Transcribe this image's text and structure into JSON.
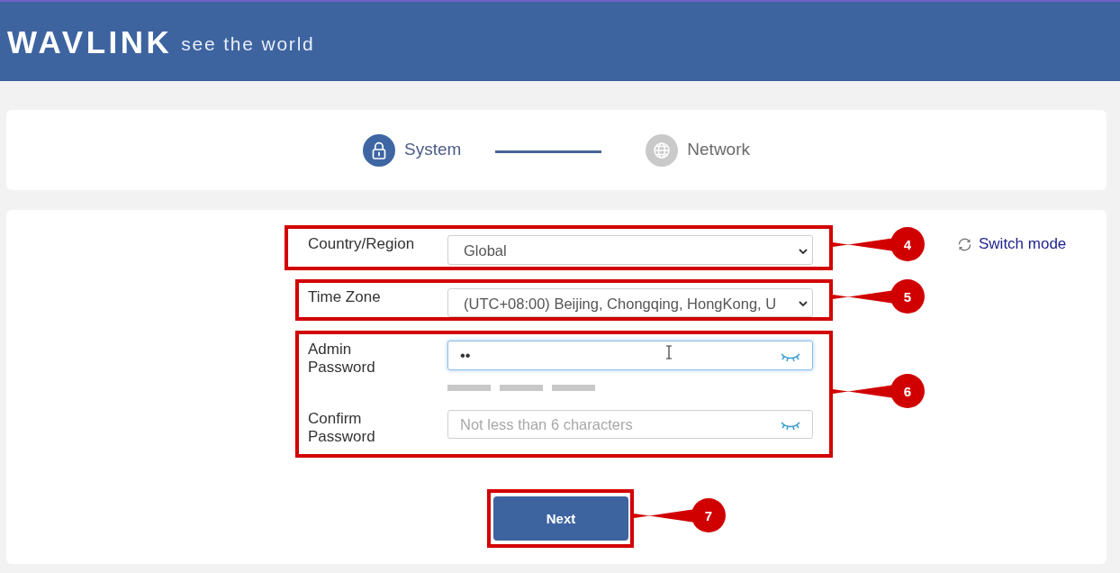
{
  "header": {
    "logo": "WAVLINK",
    "tagline": "see the world"
  },
  "steps": [
    {
      "label": "System",
      "active": true
    },
    {
      "label": "Network",
      "active": false
    }
  ],
  "switch_mode": {
    "label": "Switch mode"
  },
  "form": {
    "groups": [
      {
        "callout": "4",
        "fields": [
          {
            "kind": "select",
            "label": "Country/Region",
            "value": "Global"
          }
        ]
      },
      {
        "callout": "5",
        "fields": [
          {
            "kind": "select",
            "label": "Time Zone",
            "value": "(UTC+08:00) Beijing, Chongqing, HongKong, U"
          }
        ]
      },
      {
        "callout": "6",
        "fields": [
          {
            "kind": "password",
            "label": "Admin Password",
            "value": "••",
            "focused": true,
            "strength_bars": [
              {
                "on": false
              },
              {
                "on": false
              },
              {
                "on": false
              }
            ]
          },
          {
            "kind": "password",
            "label": "Confirm Password",
            "placeholder": "Not less than 6 characters",
            "focused": false
          }
        ]
      }
    ]
  },
  "next_button": {
    "label": "Next",
    "callout": "7"
  }
}
